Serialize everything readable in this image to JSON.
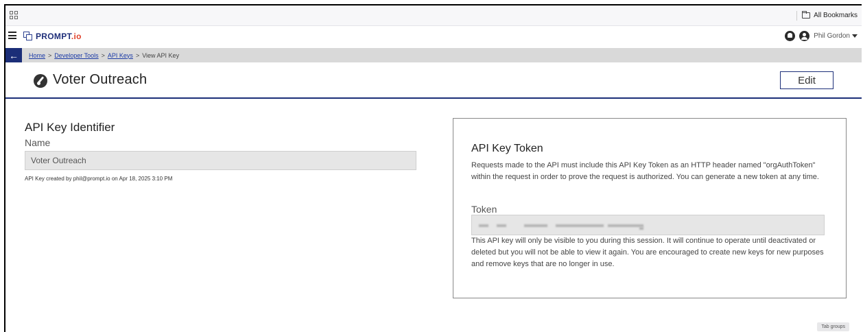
{
  "browser": {
    "all_bookmarks": "All Bookmarks",
    "tab_groups": "Tab groups"
  },
  "app": {
    "logo_word": "PROMPT",
    "logo_tld": ".io",
    "user_name": "Phil Gordon",
    "brand_color": "#1b2e78",
    "logo_accent_color": "#e0412b"
  },
  "breadcrumb": {
    "items": [
      "Home",
      "Developer Tools",
      "API Keys"
    ],
    "separator": ">",
    "current": "View API Key"
  },
  "page": {
    "title": "Voter Outreach",
    "edit_label": "Edit"
  },
  "identifier": {
    "heading": "API Key Identifier",
    "name_label": "Name",
    "name_value": "Voter Outreach",
    "created_note": "API Key created by phil@prompt.io on Apr 18, 2025 3:10 PM"
  },
  "token_card": {
    "title": "API Key Token",
    "description": "Requests made to the API must include this API Key Token as an HTTP header named \"orgAuthToken\" within the request in order to prove the request is authorized. You can generate a new token at any time.",
    "token_label": "Token",
    "note": "This API key will only be visible to you during this session. It will continue to operate until deactivated or deleted but you will not be able to view it again. You are encouraged to create new keys for new purposes and remove keys that are no longer in use."
  }
}
